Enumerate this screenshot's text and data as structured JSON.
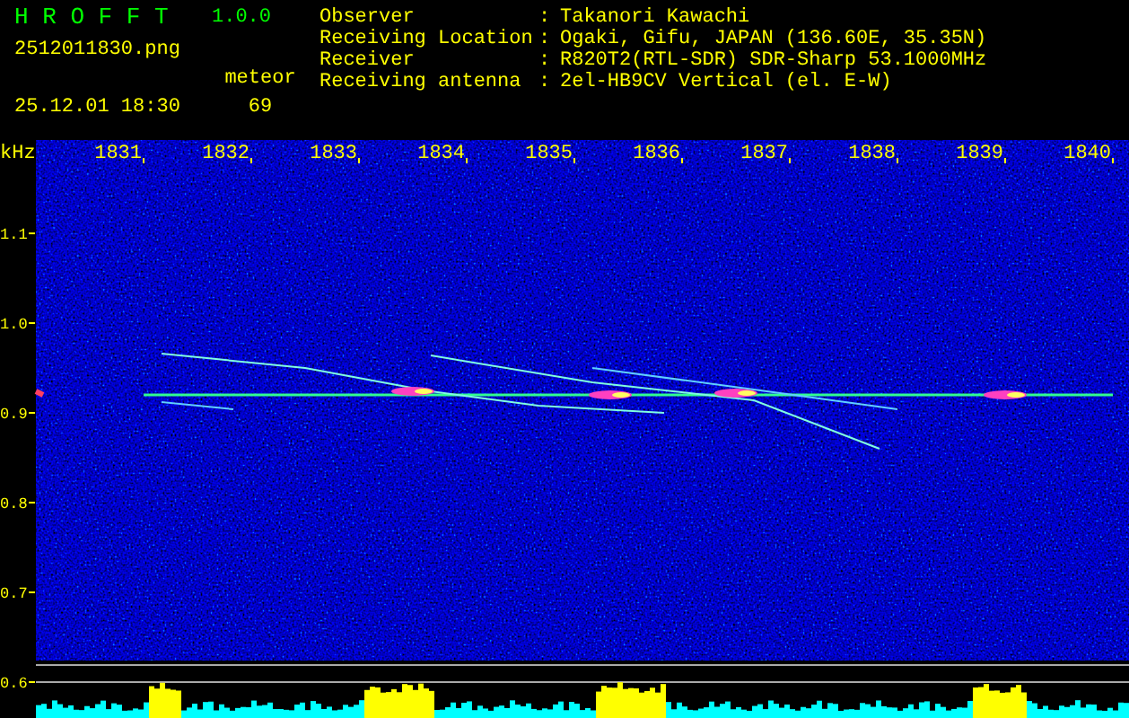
{
  "header": {
    "title": "H R O F F T",
    "version": "1.0.0",
    "filename": "2512011830.png",
    "datetime": "25.12.01 18:30",
    "count_label": "meteor",
    "count": "69"
  },
  "station_info": [
    {
      "label": "Observer",
      "separator": ":",
      "value": "Takanori Kawachi"
    },
    {
      "label": "Receiving Location",
      "separator": ":",
      "value": "Ogaki, Gifu, JAPAN (136.60E, 35.35N)"
    },
    {
      "label": "Receiver",
      "separator": ":",
      "value": "R820T2(RTL-SDR) SDR-Sharp 53.1000MHz"
    },
    {
      "label": "Receiving antenna",
      "separator": ":",
      "value": "2el-HB9CV Vertical (el. E-W)"
    }
  ],
  "spectrogram": {
    "y_unit": "kHz",
    "x_tick_labels": [
      "1831",
      "1832",
      "1833",
      "1834",
      "1835",
      "1836",
      "1837",
      "1838",
      "1839",
      "1840"
    ],
    "y_tick_labels": [
      "1.1",
      "1.0",
      "0.9",
      "0.8",
      "0.7",
      "0.6"
    ]
  }
}
